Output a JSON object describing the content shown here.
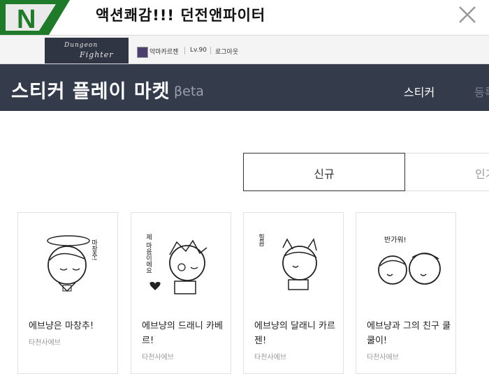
{
  "banner": {
    "text": "액션쾌감!!! 던전앤파이터",
    "logo_letter": "N"
  },
  "game_strip": {
    "logo_line1": "Dungeon",
    "logo_line2": "Fighter",
    "username": "악마카르젠",
    "level": "Lv.90",
    "logout": "로그아웃"
  },
  "header": {
    "title": "스티커 플레이 마켓",
    "beta": "βeta",
    "nav": [
      "스티커",
      "등록"
    ]
  },
  "tabs": [
    "신규",
    "인기"
  ],
  "cards": [
    {
      "title": "에브냥은 마창추!",
      "author": "타천사에브",
      "art_text": "마창추!"
    },
    {
      "title": "에브냥의 드래니 카베르!",
      "author": "타천사에브",
      "art_text": "제 마음이에요"
    },
    {
      "title": "에브냥의 달래니 카르젠!",
      "author": "타천사에브",
      "art_text": "힐끔"
    },
    {
      "title": "에브냥과 그의 친구 쿨쿨이!",
      "author": "타천사에브",
      "art_text": "반가워!"
    }
  ],
  "colors": {
    "header_bg": "#343b4b",
    "logo_green": "#1f7a2a"
  }
}
